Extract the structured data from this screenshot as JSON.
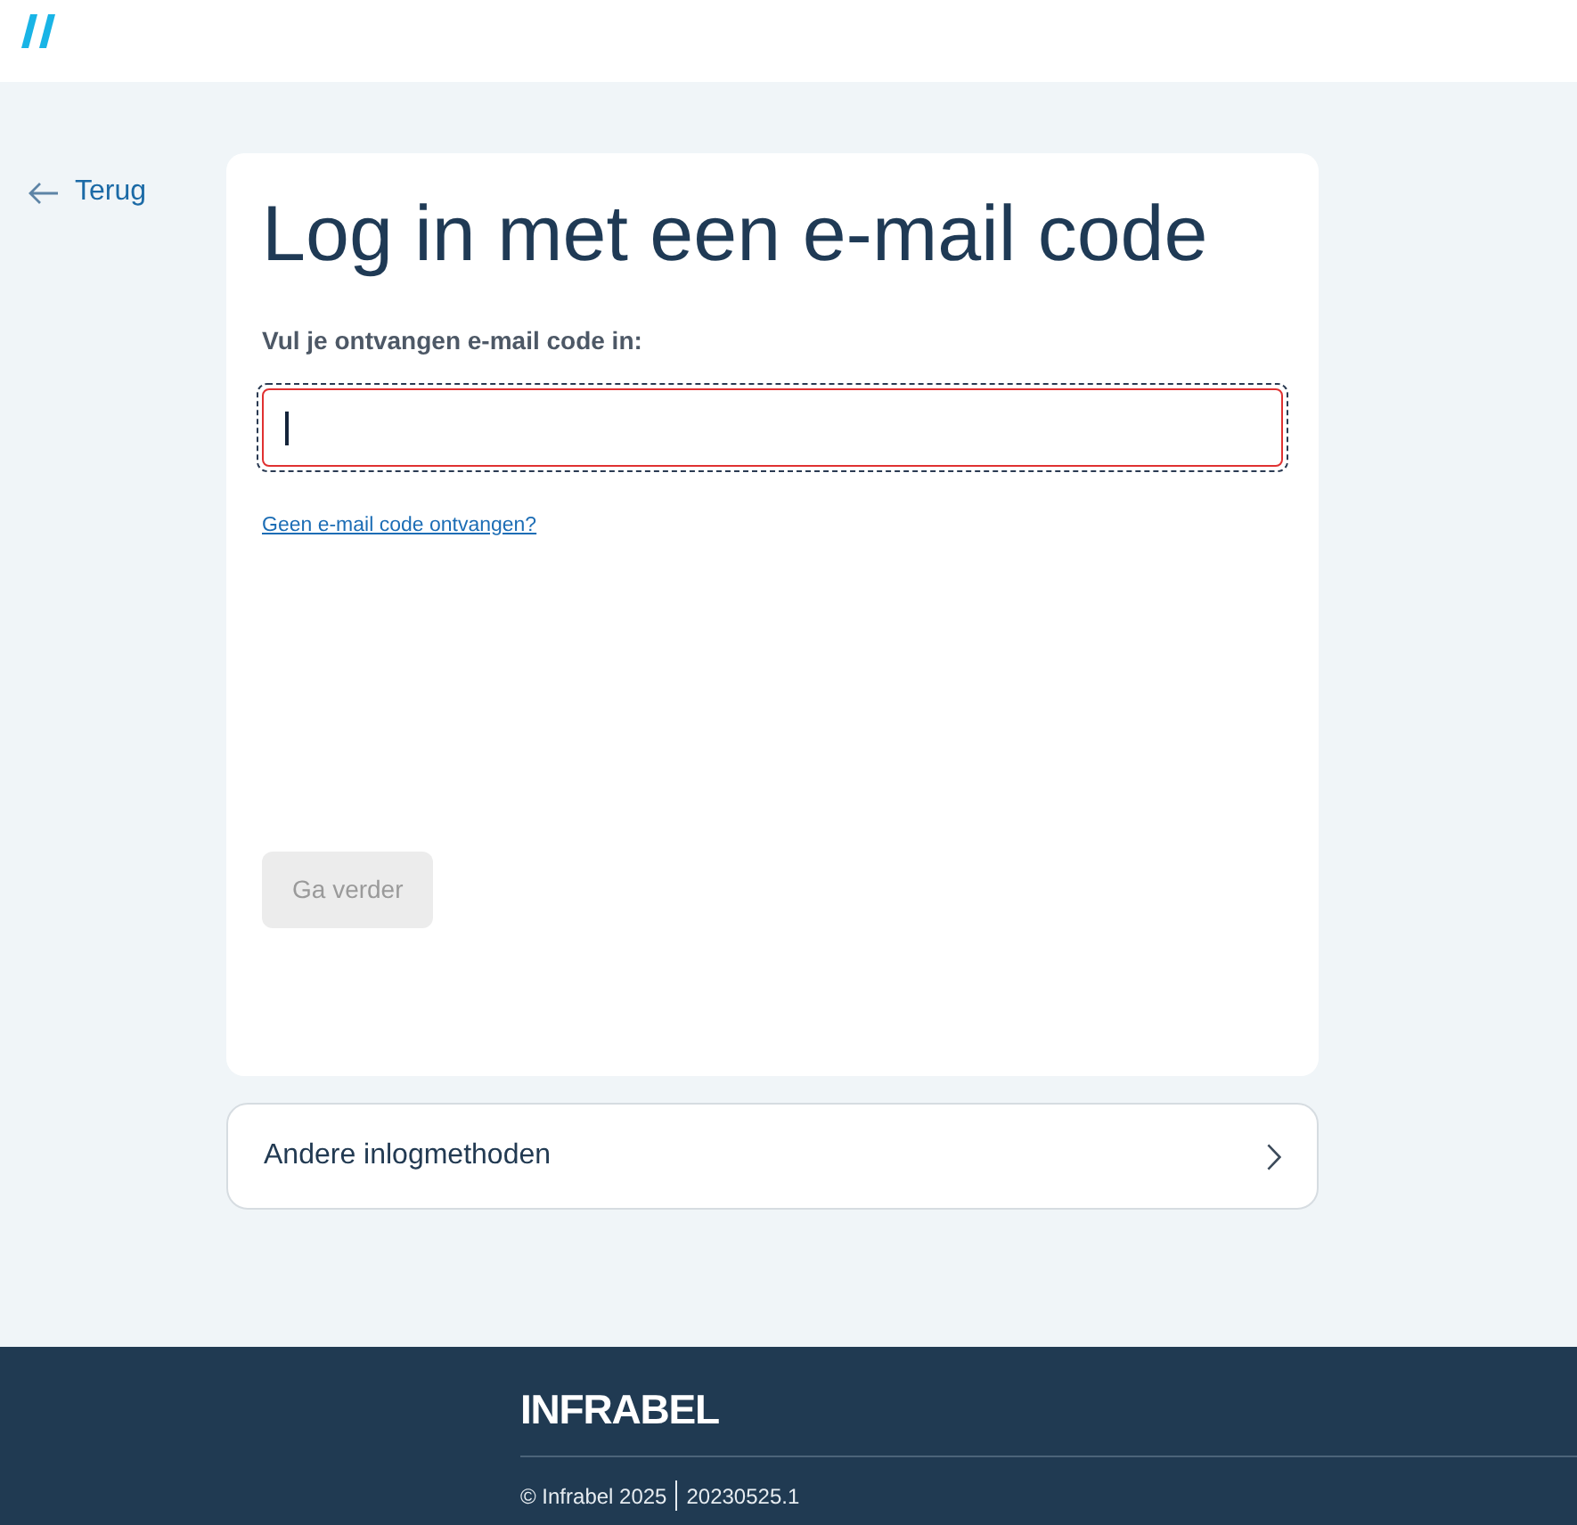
{
  "back_link": {
    "label": "Terug"
  },
  "card": {
    "title": "Log in met een e-mail code",
    "field": {
      "label": "Vul je ontvangen e-mail code in:",
      "focused": true,
      "invalid": true
    },
    "help_link": "Geen e-mail code ontvangen?",
    "submit_button": {
      "label": "Ga verder",
      "disabled": true
    }
  },
  "other_methods": {
    "label": "Andere inlogmethoden"
  },
  "footer": {
    "logo": "INFRABEL",
    "copyright": "© Infrabel 2025",
    "version": "20230525.1"
  }
}
